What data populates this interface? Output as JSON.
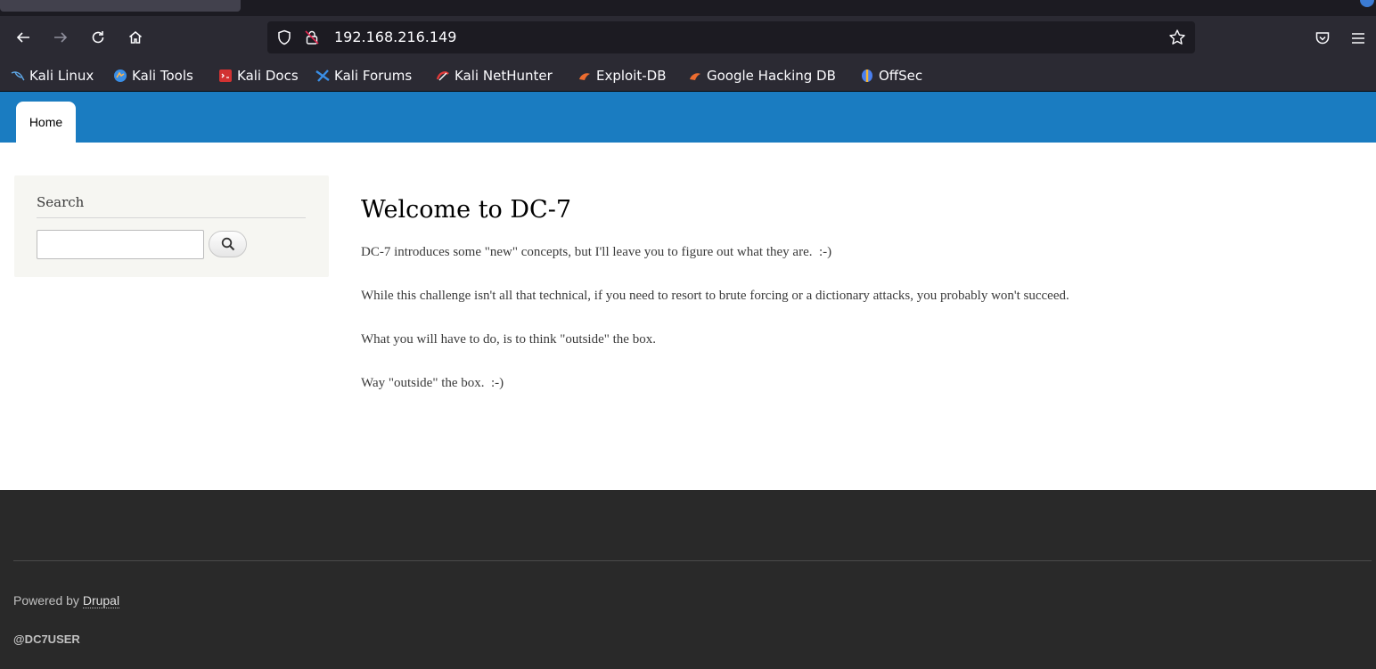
{
  "browser": {
    "url": "192.168.216.149",
    "bookmarks": [
      {
        "label": "Kali Linux",
        "icon": "kali-dragon-icon"
      },
      {
        "label": "Kali Tools",
        "icon": "kali-tools-icon"
      },
      {
        "label": "Kali Docs",
        "icon": "kali-docs-icon"
      },
      {
        "label": "Kali Forums",
        "icon": "kali-forums-icon"
      },
      {
        "label": "Kali NetHunter",
        "icon": "kali-nethunter-icon"
      },
      {
        "label": "Exploit-DB",
        "icon": "exploit-db-icon"
      },
      {
        "label": "Google Hacking DB",
        "icon": "exploit-db-icon"
      },
      {
        "label": "OffSec",
        "icon": "offsec-icon"
      }
    ]
  },
  "site": {
    "nav": {
      "home_label": "Home"
    },
    "sidebar": {
      "search_title": "Search",
      "search_value": ""
    },
    "main": {
      "title": "Welcome to DC-7",
      "paragraphs": [
        "DC-7 introduces some \"new\" concepts, but I'll leave you to figure out what they are.  :-)",
        "While this challenge isn't all that technical, if you need to resort to brute forcing or a dictionary attacks, you probably won't succeed.",
        "What you will have to do, is to think \"outside\" the box.",
        "Way \"outside\" the box.  :-)"
      ]
    },
    "footer": {
      "powered_prefix": "Powered by ",
      "powered_link": "Drupal",
      "user": "@DC7USER"
    }
  },
  "colors": {
    "header": "#1a7cc1",
    "footer": "#292929",
    "browser_chrome": "#2b2a33",
    "sidebar_block": "#f6f6f2"
  }
}
